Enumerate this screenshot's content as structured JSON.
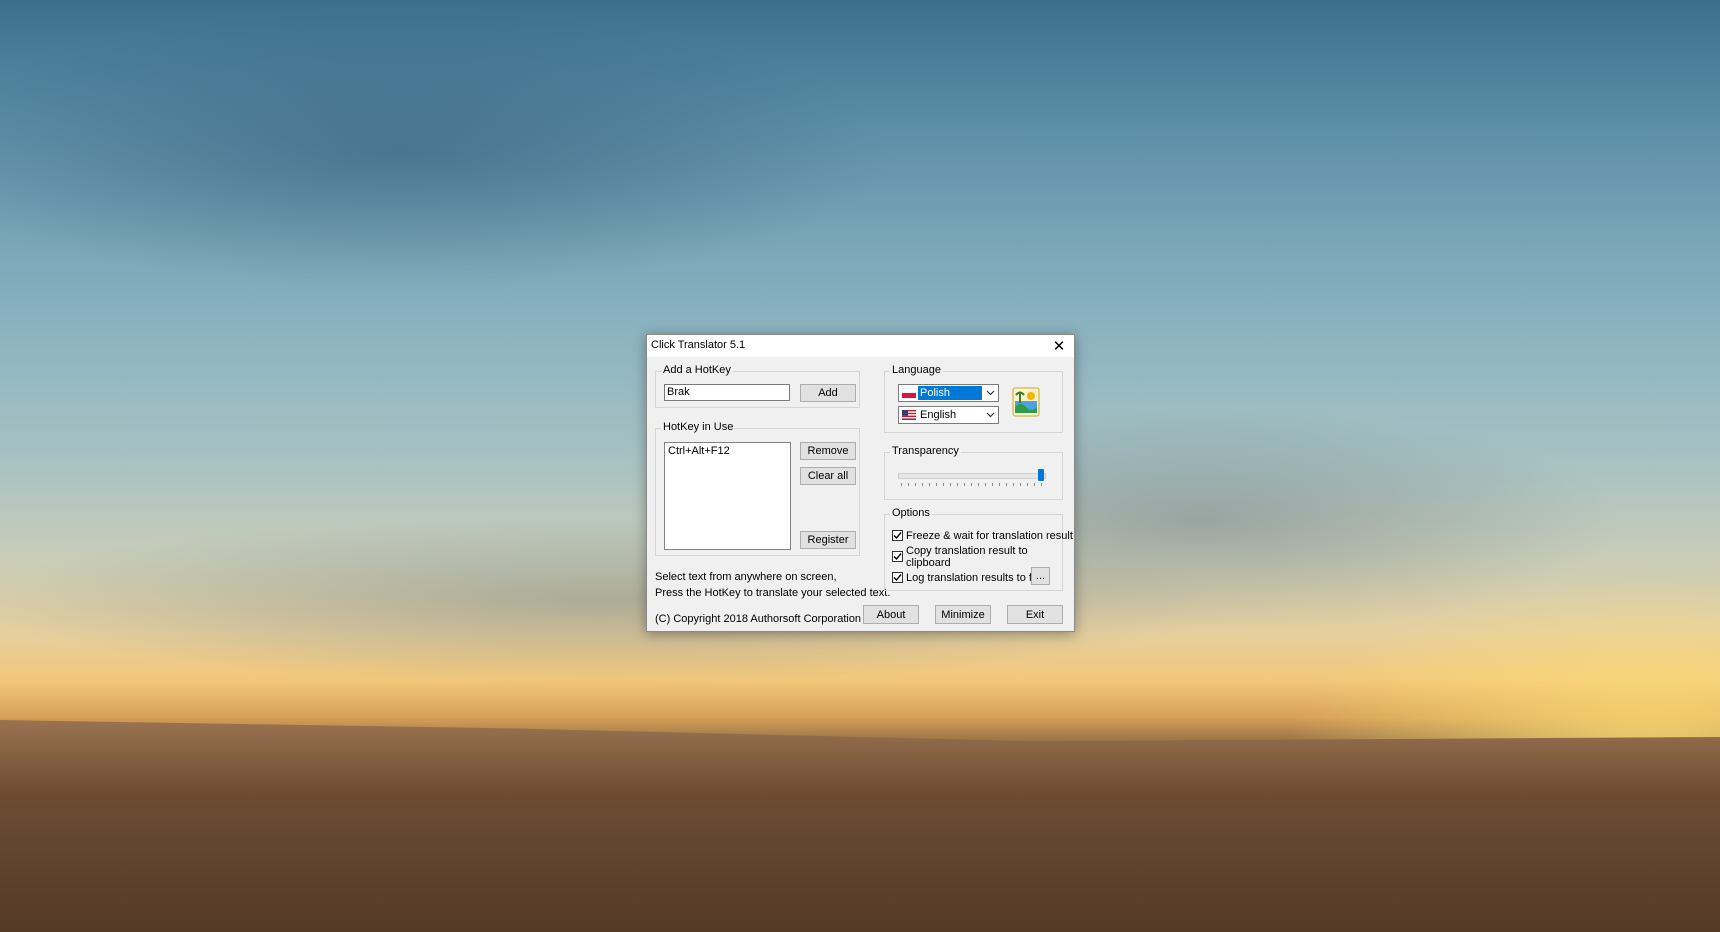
{
  "window": {
    "title": "Click Translator 5.1",
    "close_symbol": "✕"
  },
  "add_hotkey": {
    "group_label": "Add a HotKey",
    "input_value": "Brak",
    "add_label": "Add"
  },
  "hotkey_in_use": {
    "group_label": "HotKey in Use",
    "items": [
      "Ctrl+Alt+F12"
    ],
    "remove_label": "Remove",
    "clear_all_label": "Clear all",
    "register_label": "Register"
  },
  "hints": {
    "line1": "Select text from anywhere on screen,",
    "line2": "Press the HotKey to translate your selected text."
  },
  "copyright": "(C) Copyright 2018 Authorsoft Corporation",
  "language": {
    "group_label": "Language",
    "source": "Polish",
    "target": "English",
    "swap_icon": "swap-languages-icon"
  },
  "transparency": {
    "group_label": "Transparency",
    "level_percent": 100
  },
  "options": {
    "group_label": "Options",
    "freeze_label": "Freeze & wait for translation result",
    "freeze_checked": true,
    "copy_label": "Copy translation result to clipboard",
    "copy_checked": true,
    "log_label": "Log translation results to file",
    "log_checked": true,
    "browse_label": "..."
  },
  "buttons": {
    "about": "About",
    "minimize": "Minimize",
    "exit": "Exit"
  },
  "colors": {
    "selection": "#0078d7",
    "slider_thumb": "#0078d7"
  }
}
